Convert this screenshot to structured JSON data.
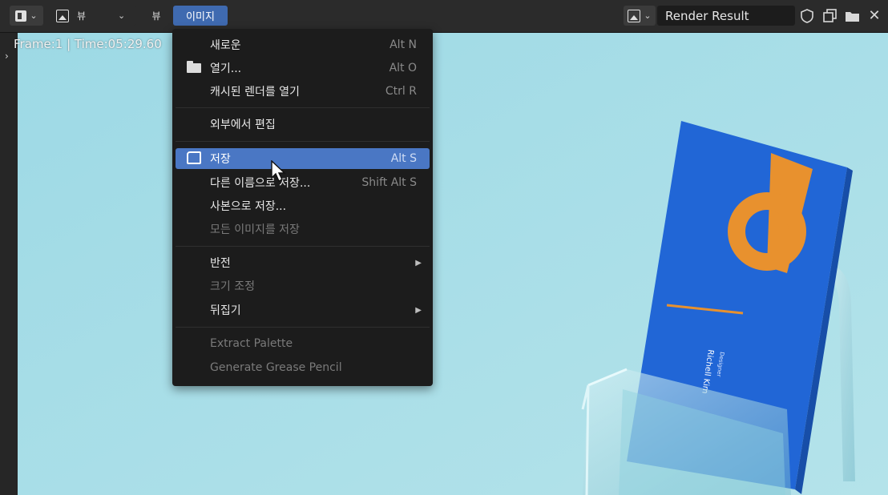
{
  "header": {
    "view_button_label": "뷰",
    "view_menu_label": "뷰",
    "image_menu_label": "이미지",
    "render_slot_name": "Render Result"
  },
  "viewport": {
    "frame_info": "Frame:1 | Time:05:29.60"
  },
  "image_menu": {
    "items": [
      {
        "label": "새로운",
        "shortcut": "Alt N"
      },
      {
        "label": "열기...",
        "shortcut": "Alt O",
        "icon": "folder-icon"
      },
      {
        "label": "캐시된 렌더를 열기",
        "shortcut": "Ctrl R"
      },
      {
        "label": "외부에서 편집"
      },
      {
        "label": "저장",
        "shortcut": "Alt S",
        "icon": "save-icon"
      },
      {
        "label": "다른 이름으로 저장...",
        "shortcut": "Shift Alt S"
      },
      {
        "label": "사본으로 저장..."
      },
      {
        "label": "모든 이미지를 저장"
      },
      {
        "label": "반전",
        "submenu": true
      },
      {
        "label": "크기 조정"
      },
      {
        "label": "뒤집기",
        "submenu": true
      },
      {
        "label": "Extract Palette"
      },
      {
        "label": "Generate Grease Pencil"
      }
    ]
  },
  "card": {
    "name": "Richell Kim",
    "role": "Designer"
  },
  "colors": {
    "menu_bg": "#1c1c1c",
    "highlight": "#4a77c4",
    "viewport_bg": "#a8dde6",
    "card_blue": "#2166d6",
    "card_logo": "#e8912e"
  },
  "icons": [
    "editor-type-icon",
    "image-icon",
    "chevron-down-icon",
    "shield-icon",
    "duplicate-icon",
    "folder-icon",
    "close-icon",
    "save-icon",
    "mouse-cursor-icon"
  ]
}
